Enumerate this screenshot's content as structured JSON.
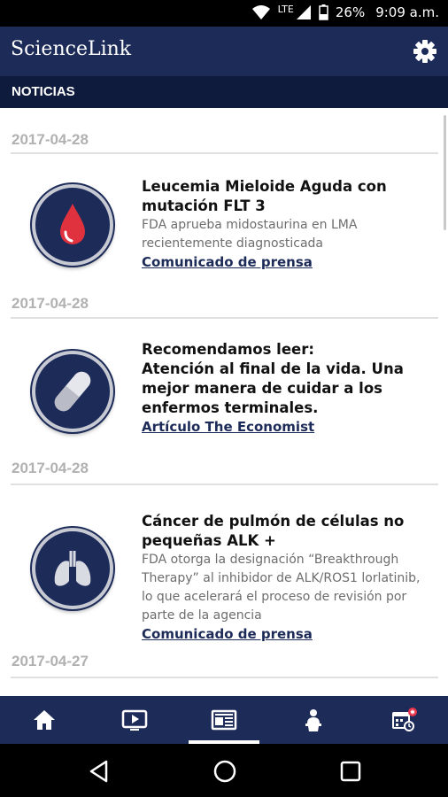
{
  "status_bar": {
    "network": "LTE",
    "battery": "26%",
    "time": "9:09 a.m.",
    "icons": [
      "wifi-icon",
      "signal-icon",
      "battery-icon"
    ]
  },
  "app": {
    "title": "ScienceLink",
    "settings_icon": "gear-icon"
  },
  "section": {
    "title": "NOTICIAS"
  },
  "news": [
    {
      "date": "2017-04-28",
      "icon": "blood-drop-icon",
      "title": "Leucemia Mieloide Aguda con mutación FLT 3",
      "description": "FDA aprueba midostaurina en LMA recientemente diagnosticada",
      "link": "Comunicado de prensa"
    },
    {
      "date": "2017-04-28",
      "icon": "pill-icon",
      "title": "Recomendamos leer:\nAtención al final de la vida. Una mejor manera de cuidar a los enfermos terminales.",
      "description": "",
      "link": "Artículo The Economist"
    },
    {
      "date": "2017-04-28",
      "icon": "lungs-icon",
      "title": "Cáncer de pulmón de células no pequeñas ALK +",
      "description": "FDA otorga la designación “Breakthrough Therapy” al inhibidor de ALK/ROS1 lorlatinib, lo que acelerará el proceso de revisión por parte de la agencia",
      "link": "Comunicado de prensa"
    },
    {
      "date": "2017-04-27"
    }
  ],
  "bottom_nav": {
    "items": [
      "home-icon",
      "video-icon",
      "news-icon",
      "speaker-icon",
      "calendar-icon"
    ],
    "active": "news-icon",
    "accent_color": "#1d2b59",
    "badge_color": "#e8344a"
  },
  "system_nav": [
    "back-icon",
    "home-circle-icon",
    "recents-icon"
  ]
}
